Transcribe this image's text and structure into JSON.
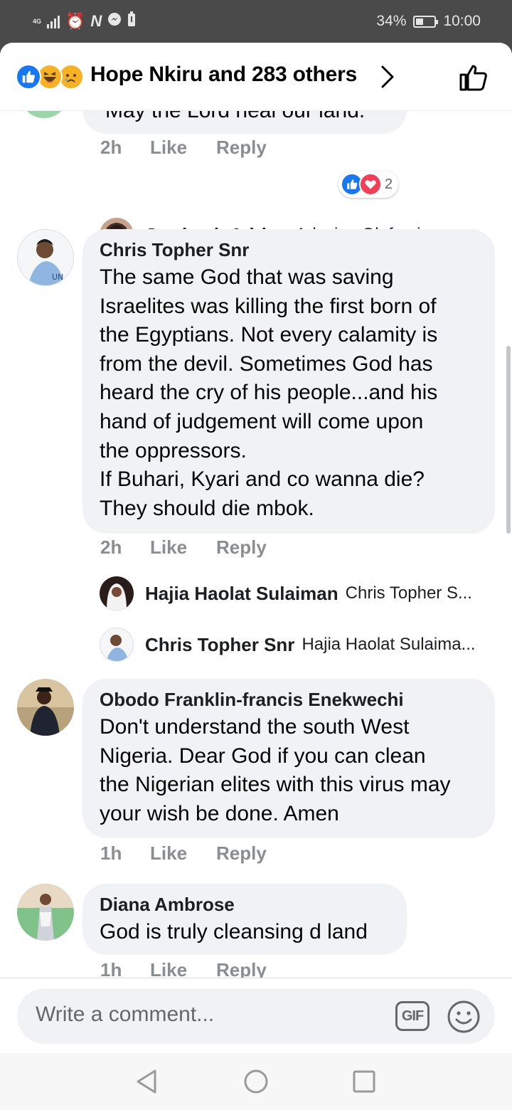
{
  "status_bar": {
    "network": "4G",
    "battery": "34%",
    "battery_level": 0.34,
    "time": "10:00"
  },
  "header": {
    "reactions": [
      "like",
      "haha",
      "sad"
    ],
    "title": "Hope Nkiru and 283 others"
  },
  "partial_comment": {
    "text": "May the Lord heal our land.",
    "time": "2h",
    "like_label": "Like",
    "reply_label": "Reply",
    "reaction_count": "2"
  },
  "replies_a": [
    {
      "name": "Jemimah Adrian",
      "text": "Adesina Olufemi amen"
    }
  ],
  "comments": [
    {
      "author": "Chris Topher Snr",
      "lines": [
        "The same God that was saving",
        "Israelites was killing the first born of",
        "the Egyptians. Not every calamity is",
        "from the devil. Sometimes God has",
        "heard the cry of his people...and his",
        "hand of judgement will come upon",
        "the oppressors.",
        "If Buhari, Kyari and co wanna die?",
        "They should die mbok."
      ],
      "time": "2h",
      "like_label": "Like",
      "reply_label": "Reply"
    },
    {
      "author": "Obodo Franklin-francis Enekwechi",
      "lines": [
        "Don't understand the south West",
        "Nigeria. Dear God if you can clean",
        "the Nigerian elites with this virus may",
        "your wish be done. Amen"
      ],
      "time": "1h",
      "like_label": "Like",
      "reply_label": "Reply"
    },
    {
      "author": "Diana Ambrose",
      "lines": [
        "God is truly cleansing d land"
      ],
      "time": "1h",
      "like_label": "Like",
      "reply_label": "Reply"
    }
  ],
  "replies_b": [
    {
      "name": "Hajia Haolat Sulaiman",
      "text": "Chris Topher S..."
    },
    {
      "name": "Chris Topher Snr",
      "text": "Hajia Haolat Sulaima..."
    }
  ],
  "composer": {
    "placeholder": "Write a comment...",
    "gif_label": "GIF"
  },
  "nav": [
    "back-icon",
    "home-icon",
    "recents-icon"
  ]
}
